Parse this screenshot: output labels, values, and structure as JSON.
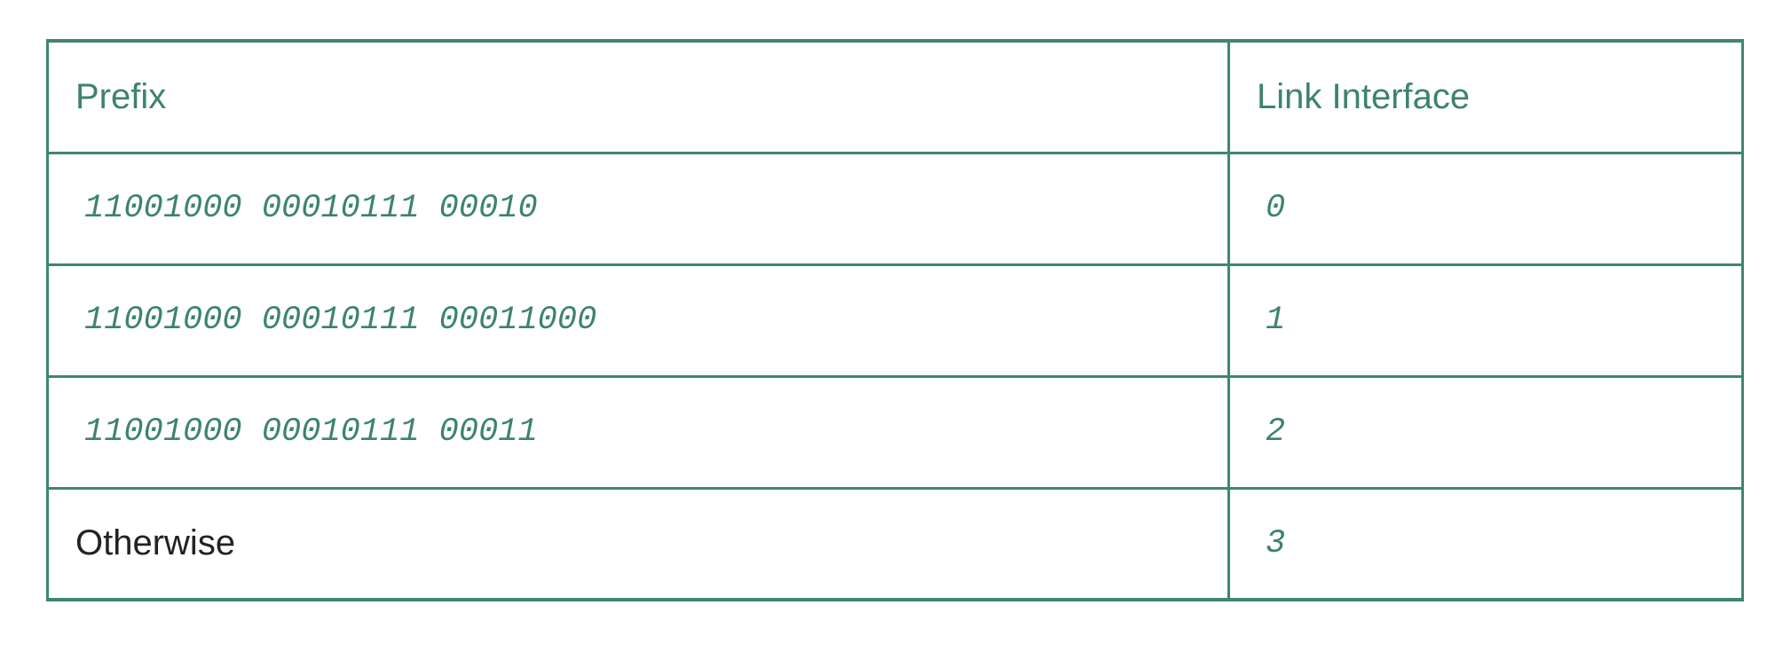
{
  "table": {
    "headers": {
      "prefix": "Prefix",
      "link_interface": "Link Interface"
    },
    "rows": [
      {
        "prefix": "11001000 00010111 00010",
        "link_interface": "0"
      },
      {
        "prefix": "11001000 00010111 00011000",
        "link_interface": "1"
      },
      {
        "prefix": "11001000 00010111 00011",
        "link_interface": "2"
      },
      {
        "prefix": "Otherwise",
        "link_interface": "3"
      }
    ]
  },
  "colors": {
    "accent": "#3f8672",
    "text_accent": "#3d836f",
    "text_plain": "#222222"
  }
}
